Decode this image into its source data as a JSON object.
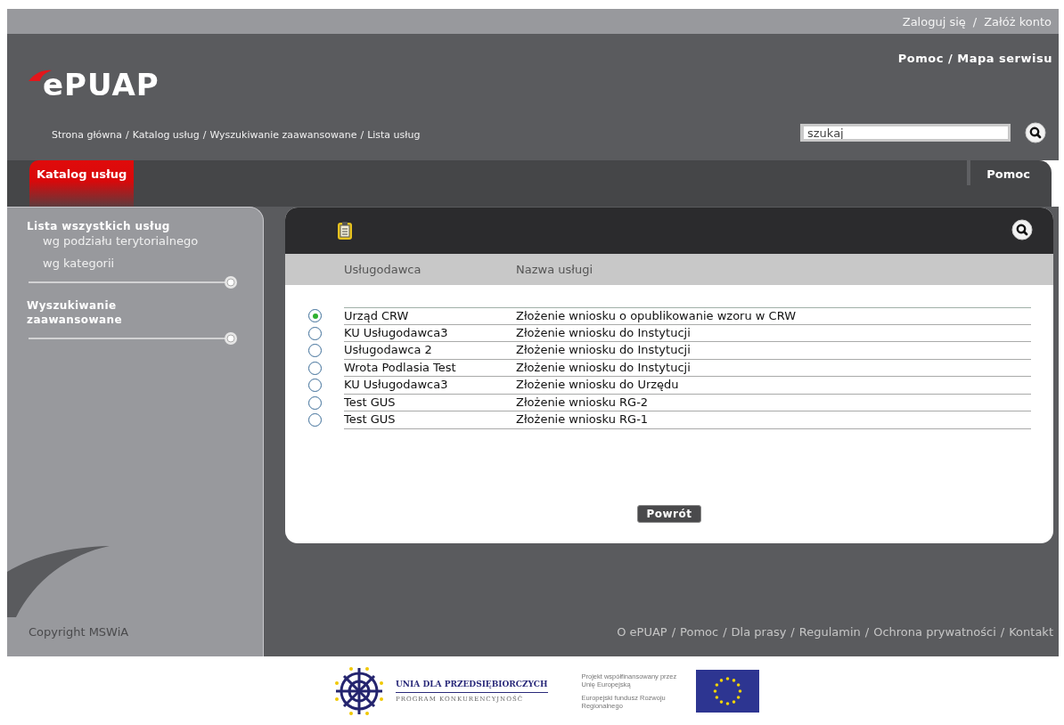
{
  "top_links": {
    "items": [
      "Zaloguj się",
      "Załóż konto"
    ],
    "separator": "/"
  },
  "logo": "ePUAP",
  "header_links": {
    "items": [
      "Pomoc",
      "Mapa serwisu"
    ],
    "separator": "/"
  },
  "breadcrumb": {
    "items": [
      "Strona główna",
      "Katalog usług",
      "Wyszukiwanie zaawansowane",
      "Lista usług"
    ],
    "separator": "/"
  },
  "search": {
    "placeholder": "szukaj"
  },
  "tabs": [
    {
      "label": "Katalog usług",
      "selected": true
    },
    {
      "label": "Pomoc",
      "selected": false
    }
  ],
  "sidebar": {
    "sections": [
      {
        "title": "Lista wszystkich usług",
        "items": [
          "wg podziału terytorialnego",
          "wg kategorii"
        ]
      },
      {
        "title": "Wyszukiwanie zaawansowane"
      }
    ],
    "copyright": "Copyright MSWiA"
  },
  "table": {
    "columns": [
      "Usługodawca",
      "Nazwa usługi"
    ],
    "rows": [
      {
        "provider": "Urząd CRW",
        "service": "Złożenie wniosku o opublikowanie wzoru w CRW",
        "selected": true
      },
      {
        "provider": "KU Usługodawca3",
        "service": "Złożenie wniosku do Instytucji",
        "selected": false
      },
      {
        "provider": "Usługodawca 2",
        "service": "Złożenie wniosku do Instytucji",
        "selected": false
      },
      {
        "provider": "Wrota Podlasia Test",
        "service": "Złożenie wniosku do Instytucji",
        "selected": false
      },
      {
        "provider": "KU Usługodawca3",
        "service": "Złożenie wniosku do Urzędu",
        "selected": false
      },
      {
        "provider": "Test GUS",
        "service": "Złożenie wniosku RG-2",
        "selected": false
      },
      {
        "provider": "Test GUS",
        "service": "Złożenie wniosku RG-1",
        "selected": false
      }
    ]
  },
  "back_button": "Powrót",
  "footer_links": {
    "items": [
      "O ePUAP",
      "Pomoc",
      "Dla prasy",
      "Regulamin",
      "Ochrona prywatności",
      "Kontakt"
    ],
    "separator": "/"
  },
  "sponsors": {
    "program_title": "UNIA DLA PRZEDSIĘBIORCZYCH",
    "program_subtitle": "PROGRAM KONKURENCYJNOŚĆ",
    "cofinance_note": "Projekt współfinansowany przez Unię Europejską",
    "fund_note": "Europejski fundusz Rozwoju Regionalnego"
  }
}
